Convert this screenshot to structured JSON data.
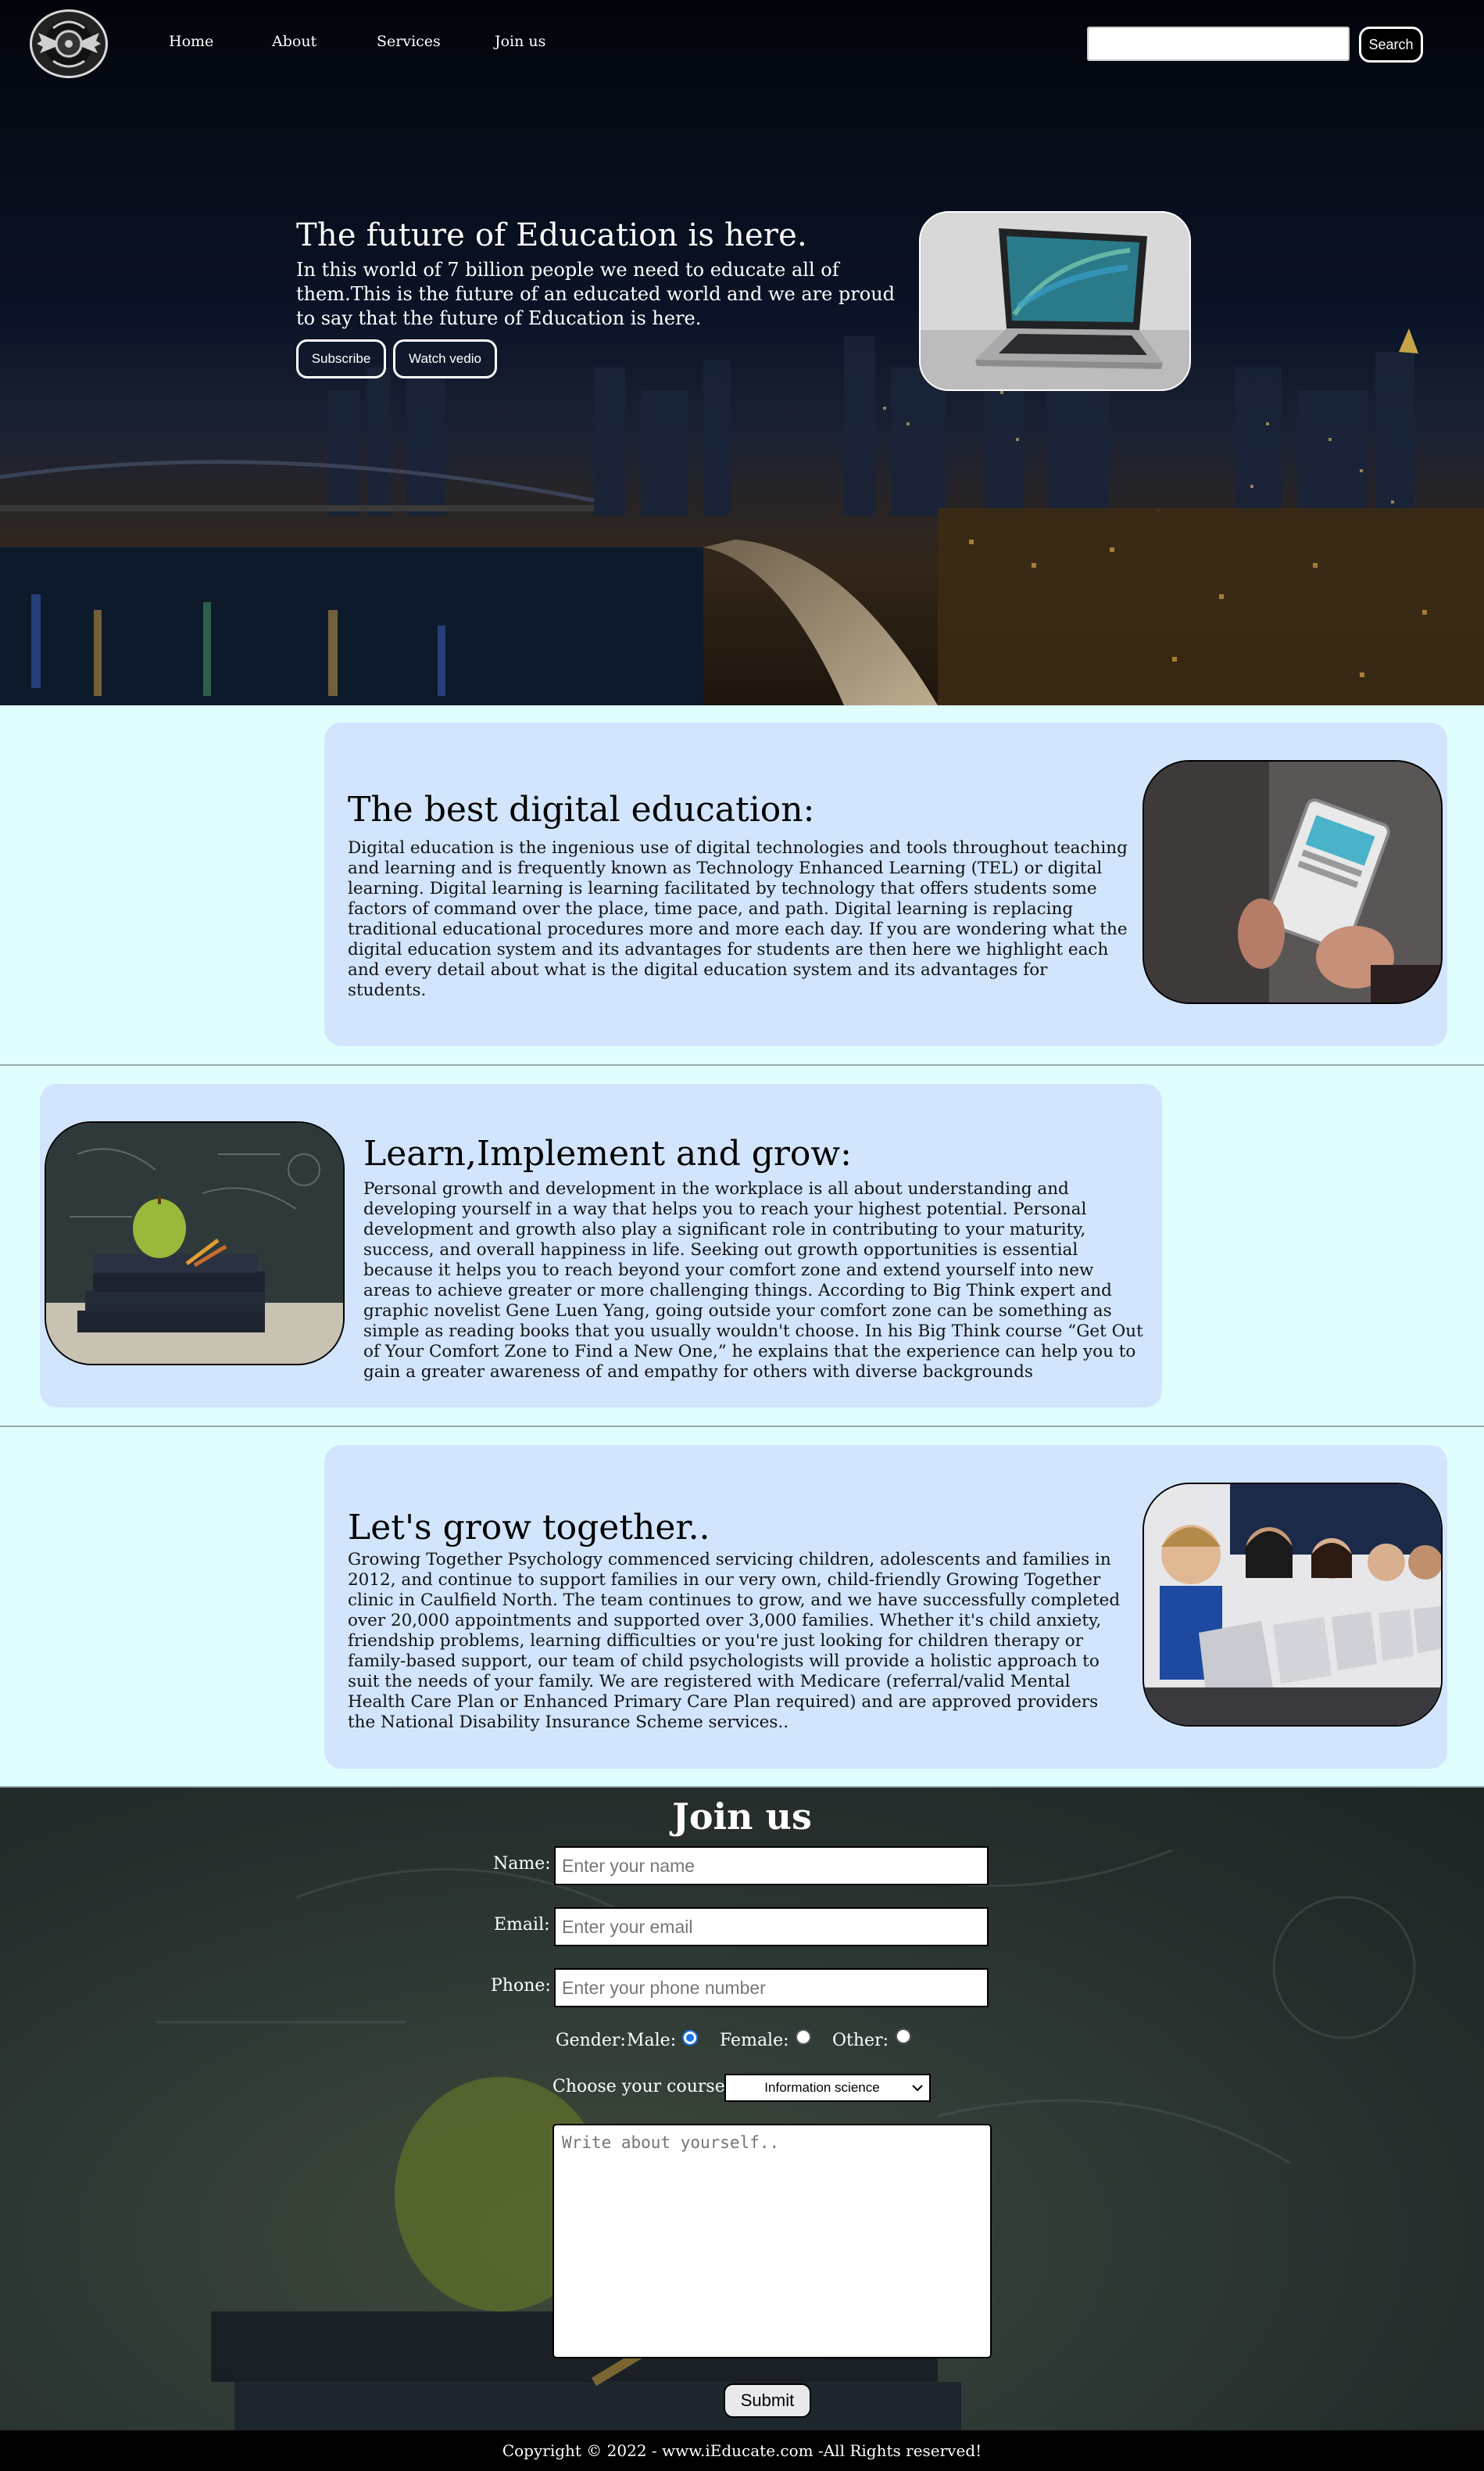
{
  "nav": {
    "links": [
      "Home",
      "About",
      "Services",
      "Join us"
    ],
    "search_placeholder": "",
    "search_button": "Search"
  },
  "hero": {
    "title": "The future of Education is here.",
    "text": "In this world of 7 billion people we need to educate all of them.This is the future of an educated world and we are proud to say that the future of Education is here.",
    "buttons": [
      "Subscribe",
      "Watch vedio"
    ]
  },
  "sections": [
    {
      "title": "The best digital education:",
      "text": "Digital education is the ingenious use of digital technologies and tools throughout teaching and learning and is frequently known as Technology Enhanced Learning (TEL) or digital learning. Digital learning is learning facilitated by technology that offers students some factors of command over the place, time pace, and path. Digital learning is replacing traditional educational procedures more and more each day. If you are wondering what the digital education system and its advantages for students are then here we highlight each and every detail about what is the digital education system and its advantages for students."
    },
    {
      "title": "Learn,Implement and grow:",
      "text": "Personal growth and development in the workplace is all about understanding and developing yourself in a way that helps you to reach your highest potential. Personal development and growth also play a significant role in contributing to your maturity, success, and overall happiness in life. Seeking out growth opportunities is essential because it helps you to reach beyond your comfort zone and extend yourself into new areas to achieve greater or more challenging things. According to Big Think expert and graphic novelist Gene Luen Yang, going outside your comfort zone can be something as simple as reading books that you usually wouldn't choose. In his Big Think course “Get Out of Your Comfort Zone to Find a New One,” he explains that the experience can help you to gain a greater awareness of and empathy for others with diverse backgrounds"
    },
    {
      "title": "Let's grow together..",
      "text": "Growing Together Psychology commenced servicing children, adolescents and families in 2012, and continue to support families in our very own, child-friendly Growing Together clinic in Caulfield North. The team continues to grow, and we have successfully completed over 20,000 appointments and supported over 3,000 families. Whether it's child anxiety, friendship problems, learning difficulties or you're just looking for children therapy or family-based support, our team of child psychologists will provide a holistic approach to suit the needs of your family. We are registered with Medicare (referral/valid Mental Health Care Plan or Enhanced Primary Care Plan required) and are approved providers the National Disability Insurance Scheme services.."
    }
  ],
  "join": {
    "title": "Join us",
    "name_label": "Name:",
    "name_placeholder": "Enter your name",
    "email_label": "Email:",
    "email_placeholder": "Enter your email",
    "phone_label": "Phone:",
    "phone_placeholder": "Enter your phone number",
    "gender_label": "Gender:",
    "gender_options": [
      "Male:",
      "Female:",
      "Other:"
    ],
    "gender_selected": "Male",
    "course_label": "Choose your course:",
    "course_selected": "Information science",
    "about_placeholder": "Write about yourself..",
    "submit": "Submit"
  },
  "footer": {
    "text": "Copyright © 2022 - www.iEducate.com -All Rights reserved!"
  },
  "icons": {
    "logo": "winged-wheel-logo",
    "dropdown": "chevron-down-icon"
  }
}
